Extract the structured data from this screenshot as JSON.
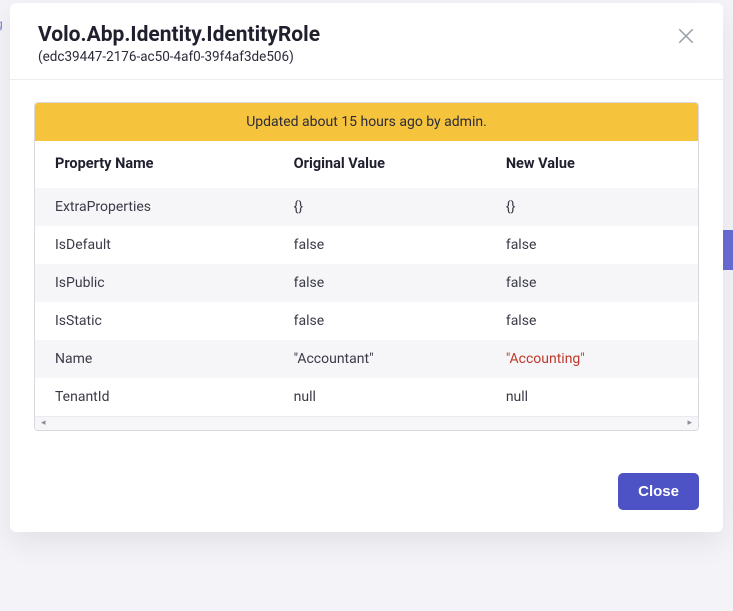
{
  "header": {
    "title": "Volo.Abp.Identity.IdentityRole",
    "subtitle": "(edc39447-2176-ac50-4af0-39f4af3de506)"
  },
  "banner": "Updated about 15 hours ago by admin.",
  "columns": {
    "property": "Property Name",
    "original": "Original Value",
    "new": "New Value"
  },
  "rows": [
    {
      "property": "ExtraProperties",
      "original": "{}",
      "new": "{}",
      "changed": false
    },
    {
      "property": "IsDefault",
      "original": "false",
      "new": "false",
      "changed": false
    },
    {
      "property": "IsPublic",
      "original": "false",
      "new": "false",
      "changed": false
    },
    {
      "property": "IsStatic",
      "original": "false",
      "new": "false",
      "changed": false
    },
    {
      "property": "Name",
      "original": "\"Accountant\"",
      "new": "\"Accounting\"",
      "changed": true
    },
    {
      "property": "TenantId",
      "original": "null",
      "new": "null",
      "changed": false
    }
  ],
  "footer": {
    "close_label": "Close"
  }
}
